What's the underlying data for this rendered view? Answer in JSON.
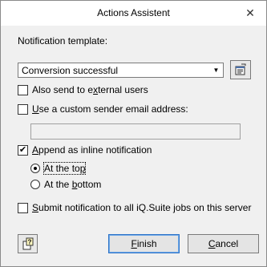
{
  "window": {
    "title": "Actions Assistent",
    "close_symbol": "✕"
  },
  "template": {
    "label": "Notification template:",
    "selected_value": "Conversion successful",
    "dropdown_arrow": "▼"
  },
  "options": {
    "external_users": {
      "label_pre": "Also send to e",
      "label_u": "x",
      "label_post": "ternal users",
      "checked": false
    },
    "custom_sender": {
      "label_pre": "",
      "label_u": "U",
      "label_post": "se a custom sender email address:",
      "checked": false,
      "email_value": ""
    },
    "inline": {
      "label_pre": "",
      "label_u": "A",
      "label_post": "ppend as inline notification",
      "checked": true,
      "check_mark": "✔"
    },
    "position_top": {
      "label_pre": "At the to",
      "label_u": "p",
      "label_post": "",
      "selected": true
    },
    "position_bottom": {
      "label_pre": "At the ",
      "label_u": "b",
      "label_post": "ottom",
      "selected": false
    },
    "submit_all": {
      "label_pre": "",
      "label_u": "S",
      "label_post": "ubmit notification to all iQ.Suite jobs on this server",
      "checked": false
    }
  },
  "buttons": {
    "finish_u": "F",
    "finish_rest": "inish",
    "cancel_u": "C",
    "cancel_rest": "ancel"
  },
  "icons": {
    "edit": "edit-template-icon",
    "help": "help-icon"
  }
}
